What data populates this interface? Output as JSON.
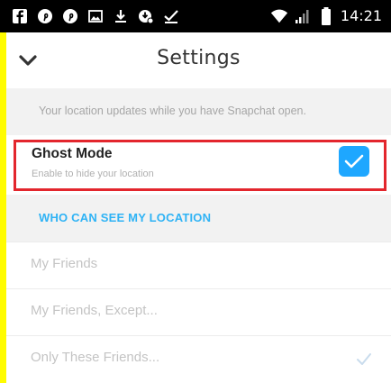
{
  "status_bar": {
    "time": "14:21",
    "left_icons": [
      "facebook-icon",
      "pinterest-icon",
      "pinterest-icon",
      "image-icon",
      "download-icon",
      "download-icon",
      "check-icon"
    ],
    "right_icons": [
      "wifi-icon",
      "signal-icon",
      "battery-icon"
    ]
  },
  "header": {
    "title": "Settings",
    "back_icon": "chevron-down-icon"
  },
  "info": {
    "text": "Your location updates while you have Snapchat open."
  },
  "ghost_mode": {
    "title": "Ghost Mode",
    "subtitle": "Enable to hide your location",
    "checked": true
  },
  "section": {
    "label": "WHO CAN SEE MY LOCATION"
  },
  "options": [
    {
      "label": "My Friends",
      "checked": false
    },
    {
      "label": "My Friends, Except...",
      "checked": false
    },
    {
      "label": "Only These Friends...",
      "checked": true
    }
  ],
  "colors": {
    "frame": "#fffc00",
    "accent": "#1ea7ff",
    "section_label": "#2fb3f5",
    "highlight": "#e3262d"
  }
}
